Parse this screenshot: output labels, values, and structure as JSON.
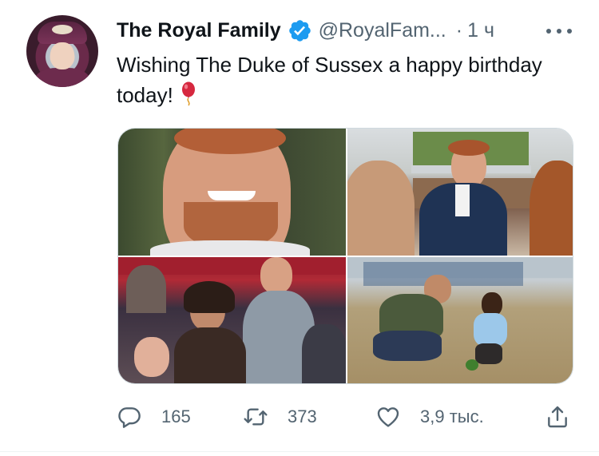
{
  "tweet": {
    "display_name": "The Royal Family",
    "verified": true,
    "handle": "@RoyalFam...",
    "separator": "·",
    "time": "1 ч",
    "text": "Wishing The Duke of Sussex a happy birthday today!",
    "emoji": "balloon-icon",
    "avatar": "avatar",
    "media": [
      {
        "id": "photo-1",
        "alt": ""
      },
      {
        "id": "photo-2",
        "alt": ""
      },
      {
        "id": "photo-3",
        "alt": ""
      },
      {
        "id": "photo-4",
        "alt": ""
      }
    ]
  },
  "actions": {
    "reply": {
      "icon": "reply-icon",
      "count": "165"
    },
    "retweet": {
      "icon": "retweet-icon",
      "count": "373"
    },
    "like": {
      "icon": "heart-icon",
      "count": "3,9 тыс."
    },
    "share": {
      "icon": "share-icon"
    }
  },
  "colors": {
    "text": "#0f1419",
    "secondary": "#536471",
    "verified": "#1d9bf0",
    "border": "#cfd9de",
    "balloon": "#d6283f"
  }
}
